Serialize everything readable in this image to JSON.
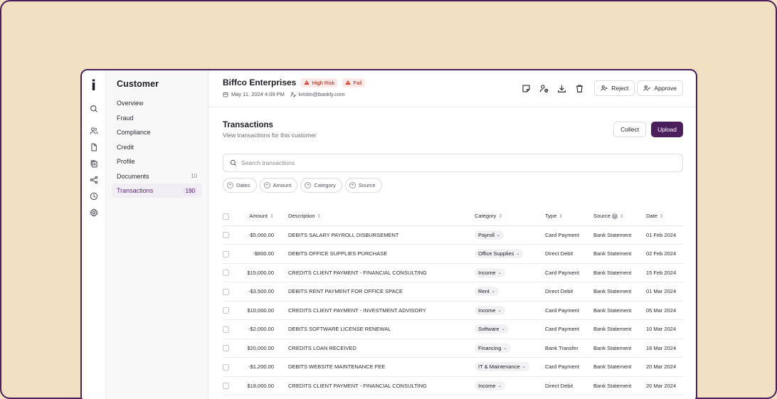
{
  "app": {
    "logo": "i"
  },
  "nav": {
    "title": "Customer",
    "items": [
      {
        "label": "Overview",
        "count": ""
      },
      {
        "label": "Fraud",
        "count": ""
      },
      {
        "label": "Compliance",
        "count": ""
      },
      {
        "label": "Credit",
        "count": ""
      },
      {
        "label": "Profile",
        "count": ""
      },
      {
        "label": "Documents",
        "count": "10"
      },
      {
        "label": "Transactions",
        "count": "190",
        "active": true
      }
    ]
  },
  "rail": {
    "icons": [
      "search-icon",
      "users-icon",
      "file-icon",
      "files-icon",
      "share-icon",
      "clock-icon",
      "gear-icon"
    ]
  },
  "header": {
    "customer_name": "Biffco Enterprises",
    "badges": [
      "High Risk",
      "Fail"
    ],
    "date": "May 11, 2024 4:09 PM",
    "email": "kristin@bankly.com",
    "reject_label": "Reject",
    "approve_label": "Approve"
  },
  "section": {
    "title": "Transactions",
    "subtitle": "View transactions for this customer",
    "collect_label": "Collect",
    "upload_label": "Upload"
  },
  "search": {
    "placeholder": "Search transactions"
  },
  "filters": [
    "Dates",
    "Amount",
    "Category",
    "Source"
  ],
  "table": {
    "columns": [
      "Amount",
      "Description",
      "Category",
      "Type",
      "Source",
      "Date"
    ],
    "rows": [
      {
        "amount": "-$5,000.00",
        "description": "DEBITS SALARY PAYROLL DISBURSEMENT",
        "category": "Payroll",
        "type": "Card Payment",
        "source": "Bank Statement",
        "date": "01 Feb 2024"
      },
      {
        "amount": "-$800.00",
        "description": "DEBITS OFFICE SUPPLIES PURCHASE",
        "category": "Office Supplies",
        "type": "Direct Debit",
        "source": "Bank Statement",
        "date": "02 Feb 2024"
      },
      {
        "amount": "$15,000.00",
        "description": "CREDITS CLIENT PAYMENT - FINANCIAL CONSULTING",
        "category": "Income",
        "type": "Card Payment",
        "source": "Bank Statement",
        "date": "15 Feb 2024"
      },
      {
        "amount": "-$3,500.00",
        "description": "DEBITS RENT PAYMENT FOR OFFICE SPACE",
        "category": "Rent",
        "type": "Direct Debit",
        "source": "Bank Statement",
        "date": "01 Mar 2024"
      },
      {
        "amount": "$10,000.00",
        "description": "CREDITS CLIENT PAYMENT - INVESTMENT ADVISORY",
        "category": "Income",
        "type": "Card Payment",
        "source": "Bank Statement",
        "date": "05 Mar 2024"
      },
      {
        "amount": "-$2,000.00",
        "description": "DEBITS SOFTWARE LICENSE RENEWAL",
        "category": "Software",
        "type": "Card Payment",
        "source": "Bank Statement",
        "date": "10 Mar 2024"
      },
      {
        "amount": "$20,000.00",
        "description": "CREDITS LOAN RECEIVED",
        "category": "Financing",
        "type": "Bank Transfer",
        "source": "Bank Statement",
        "date": "18 Mar 2024"
      },
      {
        "amount": "-$1,200.00",
        "description": "DEBITS WEBSITE MAINTENANCE FEE",
        "category": "IT & Maintenance",
        "type": "Card Payment",
        "source": "Bank Statement",
        "date": "20 Mar 2024"
      },
      {
        "amount": "$18,000.00",
        "description": "CREDITS CLIENT PAYMENT - FINANCIAL CONSULTING",
        "category": "Income",
        "type": "Direct Debit",
        "source": "Bank Statement",
        "date": "20 Mar 2024"
      }
    ]
  },
  "colors": {
    "accent": "#4a1f5c",
    "background": "#f1e1c2",
    "badge_bg": "#fde8e8",
    "badge_text": "#b42318"
  }
}
